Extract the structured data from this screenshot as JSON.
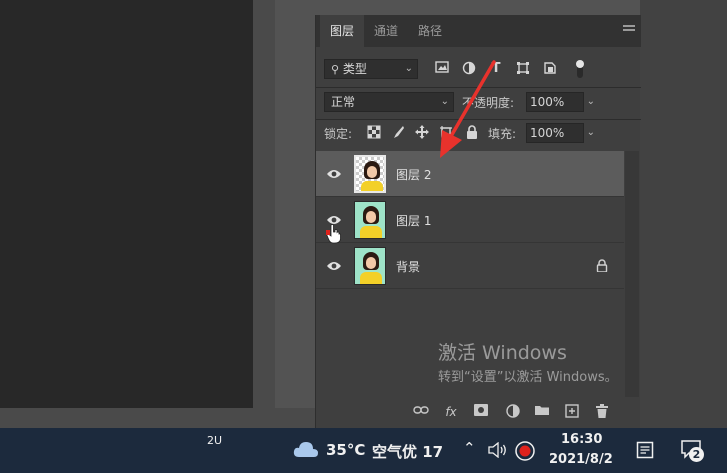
{
  "panel": {
    "tabs": [
      "图层",
      "通道",
      "路径"
    ],
    "filter": {
      "kind_label": "类型"
    },
    "blend_mode": "正常",
    "opacity_label": "不透明度:",
    "opacity_value": "100%",
    "lock_label": "锁定:",
    "fill_label": "填充:",
    "fill_value": "100%",
    "layers": [
      {
        "name": "图层 2",
        "selected": true
      },
      {
        "name": "图层 1",
        "selected": false
      },
      {
        "name": "背景",
        "selected": false,
        "locked": true
      }
    ]
  },
  "watermark": {
    "title": "激活 Windows",
    "subtitle": "转到“设置”以激活 Windows。"
  },
  "taskbar": {
    "left_label": "2U",
    "weather_temp": "35°C",
    "air_quality": "空气优 17",
    "time": "16:30",
    "date": "2021/8/2",
    "notification_count": "2"
  },
  "colors": {
    "accent_arrow": "#e8322c",
    "taskbar_bg": "#1c2a3d",
    "record_red": "#e0221c"
  }
}
